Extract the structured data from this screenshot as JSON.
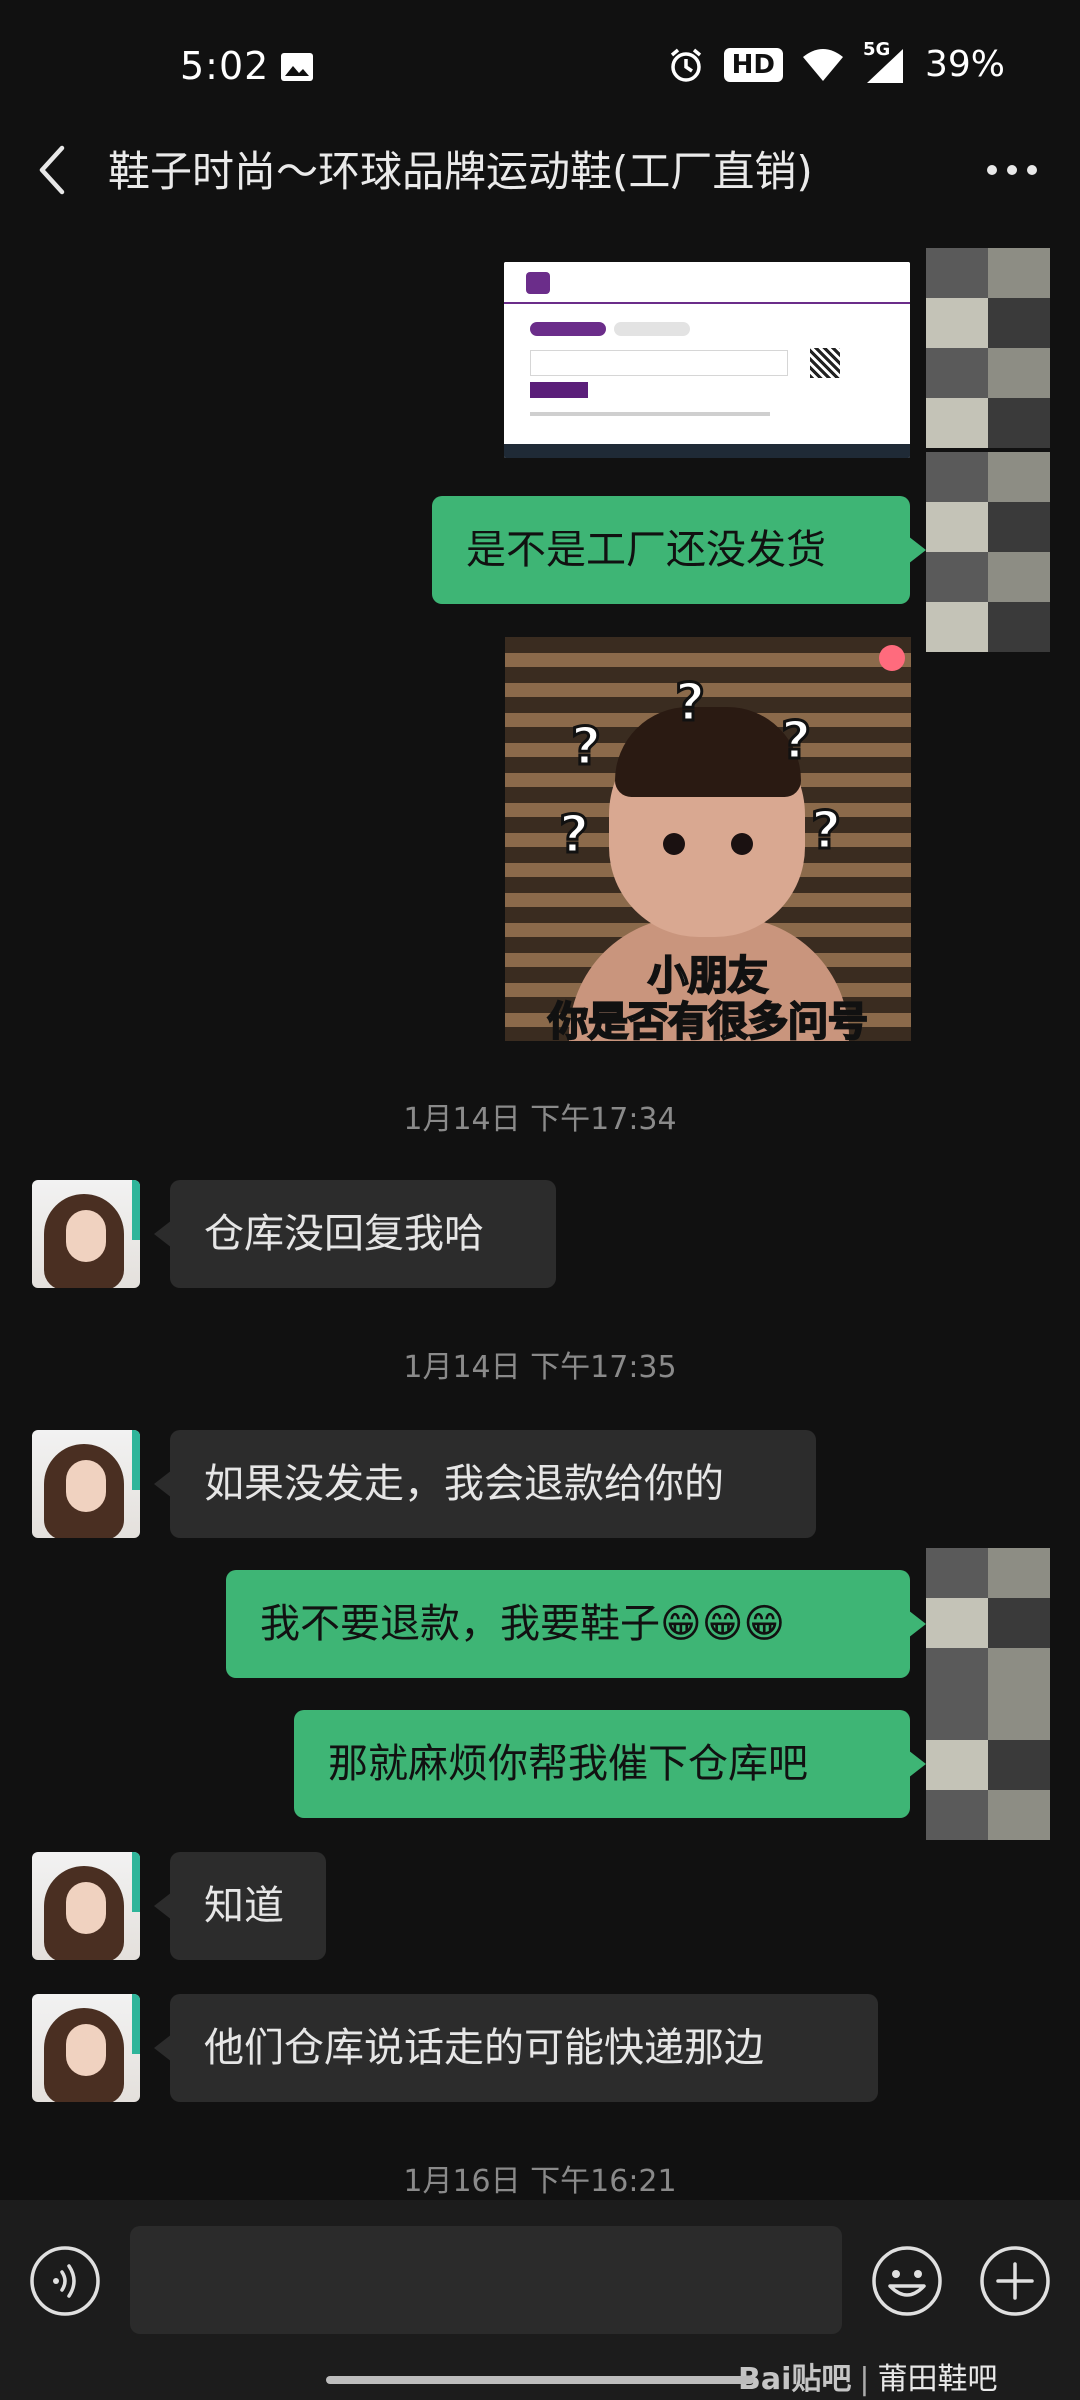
{
  "status_bar": {
    "time": "5:02",
    "hd": "HD",
    "network": "5G",
    "battery": "39%"
  },
  "header": {
    "title": "鞋子时尚～环球品牌运动鞋(工厂直销)"
  },
  "messages": {
    "m1": "是不是工厂还没发货",
    "ts1": "1月14日 下午17:34",
    "m2": "仓库没回复我哈",
    "ts2": "1月14日 下午17:35",
    "m3": "如果没发走，我会退款给你的",
    "m4": "我不要退款，我要鞋子😁😁😁",
    "m5": "那就麻烦你帮我催下仓库吧",
    "m6": "知道",
    "m7": "他们仓库说话走的可能快递那边",
    "ts3": "1月16日 下午16:21"
  },
  "sticker": {
    "line1": "小朋友",
    "line2": "你是否有很多问号"
  },
  "watermark": {
    "brand": "Bai贴吧",
    "forum": "莆田鞋吧"
  },
  "colors": {
    "background": "#111111",
    "outgoing_bubble": "#3eb575",
    "incoming_bubble": "#2c2c2c",
    "input_bar": "#1c1c1c"
  }
}
